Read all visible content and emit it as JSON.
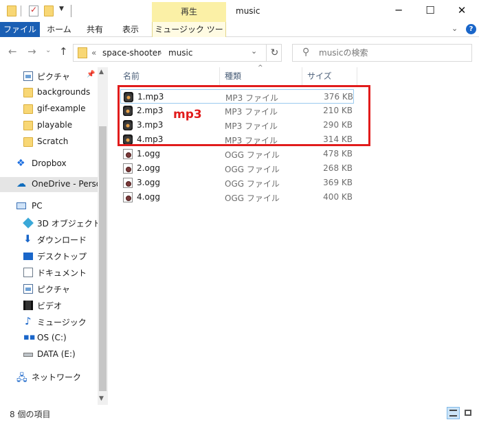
{
  "titlebar": {
    "context_tab": "再生",
    "window_title": "music",
    "buttons": {
      "minimize": "─",
      "maximize": "☐",
      "close": "✕"
    }
  },
  "ribbon": {
    "tabs": [
      "ファイル",
      "ホーム",
      "共有",
      "表示",
      "ミュージック ツール"
    ]
  },
  "address": {
    "crumb_prefix": "«",
    "crumbs": [
      "space-shooter",
      "music"
    ],
    "sep": "›",
    "search_placeholder": "musicの検索"
  },
  "nav": {
    "items": [
      {
        "label": "ピクチャ"
      },
      {
        "label": "backgrounds"
      },
      {
        "label": "gif-example"
      },
      {
        "label": "playable"
      },
      {
        "label": "Scratch"
      },
      {
        "label": "Dropbox"
      },
      {
        "label": "OneDrive - Person"
      },
      {
        "label": "PC"
      },
      {
        "label": "3D オブジェクト"
      },
      {
        "label": "ダウンロード"
      },
      {
        "label": "デスクトップ"
      },
      {
        "label": "ドキュメント"
      },
      {
        "label": "ピクチャ"
      },
      {
        "label": "ビデオ"
      },
      {
        "label": "ミュージック"
      },
      {
        "label": "OS (C:)"
      },
      {
        "label": "DATA (E:)"
      },
      {
        "label": "ネットワーク"
      }
    ]
  },
  "columns": {
    "name": "名前",
    "type": "種類",
    "size": "サイズ"
  },
  "files": [
    {
      "name": "1.mp3",
      "type": "MP3 ファイル",
      "size": "376 KB"
    },
    {
      "name": "2.mp3",
      "type": "MP3 ファイル",
      "size": "210 KB"
    },
    {
      "name": "3.mp3",
      "type": "MP3 ファイル",
      "size": "290 KB"
    },
    {
      "name": "4.mp3",
      "type": "MP3 ファイル",
      "size": "314 KB"
    },
    {
      "name": "1.ogg",
      "type": "OGG ファイル",
      "size": "478 KB"
    },
    {
      "name": "2.ogg",
      "type": "OGG ファイル",
      "size": "268 KB"
    },
    {
      "name": "3.ogg",
      "type": "OGG ファイル",
      "size": "369 KB"
    },
    {
      "name": "4.ogg",
      "type": "OGG ファイル",
      "size": "400 KB"
    }
  ],
  "annotation": {
    "label": "mp3",
    "color": "#e11b1b"
  },
  "status": {
    "count": "8 個の項目"
  }
}
